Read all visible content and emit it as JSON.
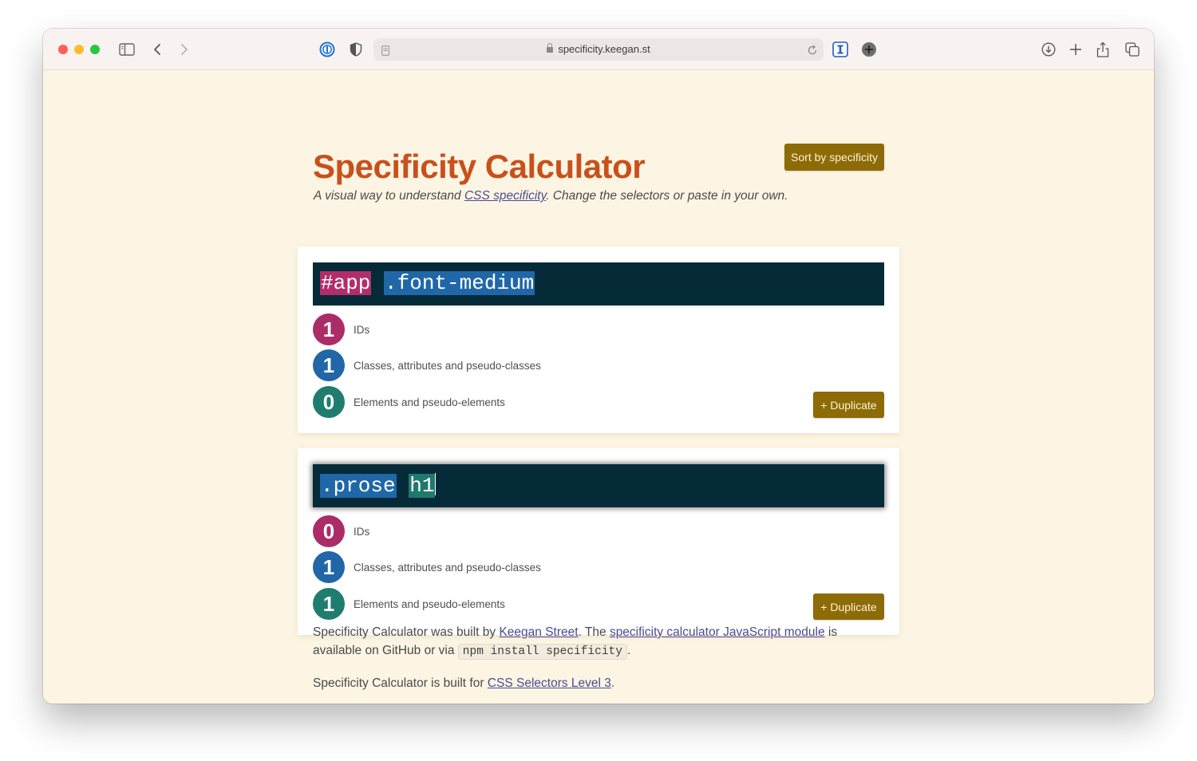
{
  "browser": {
    "url": "specificity.keegan.st",
    "icons": [
      "sidebar-icon",
      "back-icon",
      "forward-icon",
      "onepassword-icon",
      "shield-icon",
      "page-icon",
      "reload-icon",
      "text-cursor-extension-icon",
      "add-extension-icon",
      "download-icon",
      "new-tab-icon",
      "share-icon",
      "tabs-overview-icon"
    ]
  },
  "header": {
    "title": "Specificity Calculator",
    "subtitle_before": "A visual way to understand ",
    "subtitle_link": "CSS specificity",
    "subtitle_after": ". Change the selectors or paste in your own.",
    "sort_button": "Sort by specificity"
  },
  "labels": {
    "ids": "IDs",
    "classes": "Classes, attributes and pseudo-classes",
    "elements": "Elements and pseudo-elements",
    "duplicate": "+ Duplicate"
  },
  "cards": [
    {
      "tokens": [
        {
          "text": "#app",
          "type": "id"
        },
        {
          "text": ".font-medium",
          "type": "class"
        }
      ],
      "ids": "1",
      "classes": "1",
      "elements": "0"
    },
    {
      "tokens": [
        {
          "text": ".prose",
          "type": "class"
        },
        {
          "text": "h1",
          "type": "element"
        }
      ],
      "ids": "0",
      "classes": "1",
      "elements": "1",
      "focused": true
    }
  ],
  "footer": {
    "p1_a": "Specificity Calculator was built by ",
    "p1_link1": "Keegan Street",
    "p1_b": ". The ",
    "p1_link2": "specificity calculator JavaScript module",
    "p1_c": " is available on GitHub or via ",
    "p1_code": "npm install specificity",
    "p1_d": ".",
    "p2_a": "Specificity Calculator is built for ",
    "p2_link": "CSS Selectors Level 3",
    "p2_b": "."
  },
  "colors": {
    "title": "#c9501c",
    "button": "#8d6b06",
    "id": "#ab2c67",
    "class": "#2166a6",
    "element": "#1f7d6f",
    "selector_bg": "#052a38",
    "page_bg": "#fdf5e3"
  }
}
